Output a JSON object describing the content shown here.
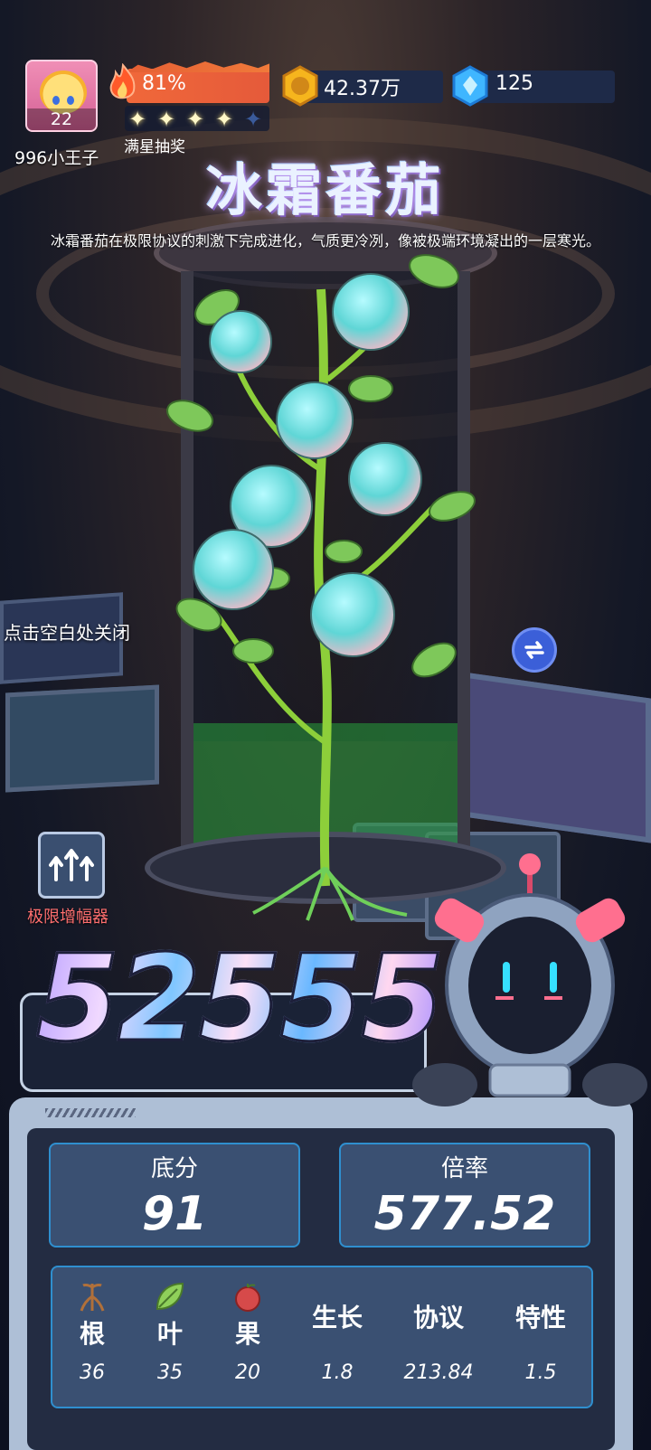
{
  "player": {
    "name": "996小王子",
    "level": "22"
  },
  "energy": {
    "percent_text": "81%",
    "percent": 81
  },
  "stars": {
    "filled": 4,
    "total": 5,
    "label": "满星抽奖"
  },
  "currency": {
    "coins": "42.37万",
    "gems": "125"
  },
  "plant": {
    "title": "冰霜番茄",
    "description": "冰霜番茄在极限协议的刺激下完成进化，气质更冷冽，像被极端环境凝出的一层寒光。"
  },
  "hints": {
    "close": "点击空白处关闭"
  },
  "amplifier": {
    "label": "极限增幅器"
  },
  "score": {
    "total": "52555",
    "base_label": "底分",
    "base_value": "91",
    "multiplier_label": "倍率",
    "multiplier_value": "577.52"
  },
  "attributes": [
    {
      "label": "根",
      "value": "36",
      "icon": "root-icon"
    },
    {
      "label": "叶",
      "value": "35",
      "icon": "leaf-icon"
    },
    {
      "label": "果",
      "value": "20",
      "icon": "fruit-icon"
    },
    {
      "label": "生长",
      "value": "1.8"
    },
    {
      "label": "协议",
      "value": "213.84"
    },
    {
      "label": "特性",
      "value": "1.5"
    }
  ],
  "colors": {
    "accent_blue": "#3b5fd8",
    "panel_border": "#2f8fcf",
    "amplifier_red": "#ff6f6f",
    "energy_orange": "#f0683a"
  }
}
